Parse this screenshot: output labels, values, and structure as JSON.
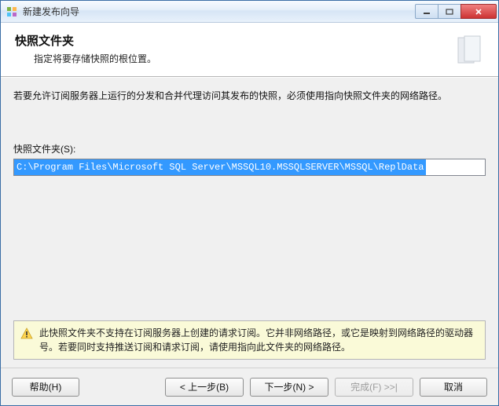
{
  "window": {
    "title": "新建发布向导"
  },
  "header": {
    "title": "快照文件夹",
    "subtitle": "指定将要存储快照的根位置。"
  },
  "content": {
    "description": "若要允许订阅服务器上运行的分发和合并代理访问其发布的快照，必须使用指向快照文件夹的网络路径。",
    "field_label": "快照文件夹(S):",
    "path_value": "C:\\Program Files\\Microsoft SQL Server\\MSSQL10.MSSQLSERVER\\MSSQL\\ReplData"
  },
  "warning": {
    "text": "此快照文件夹不支持在订阅服务器上创建的请求订阅。它并非网络路径，或它是映射到网络路径的驱动器号。若要同时支持推送订阅和请求订阅，请使用指向此文件夹的网络路径。"
  },
  "footer": {
    "help": "帮助(H)",
    "back": "< 上一步(B)",
    "next": "下一步(N) >",
    "finish": "完成(F) >>|",
    "cancel": "取消"
  }
}
